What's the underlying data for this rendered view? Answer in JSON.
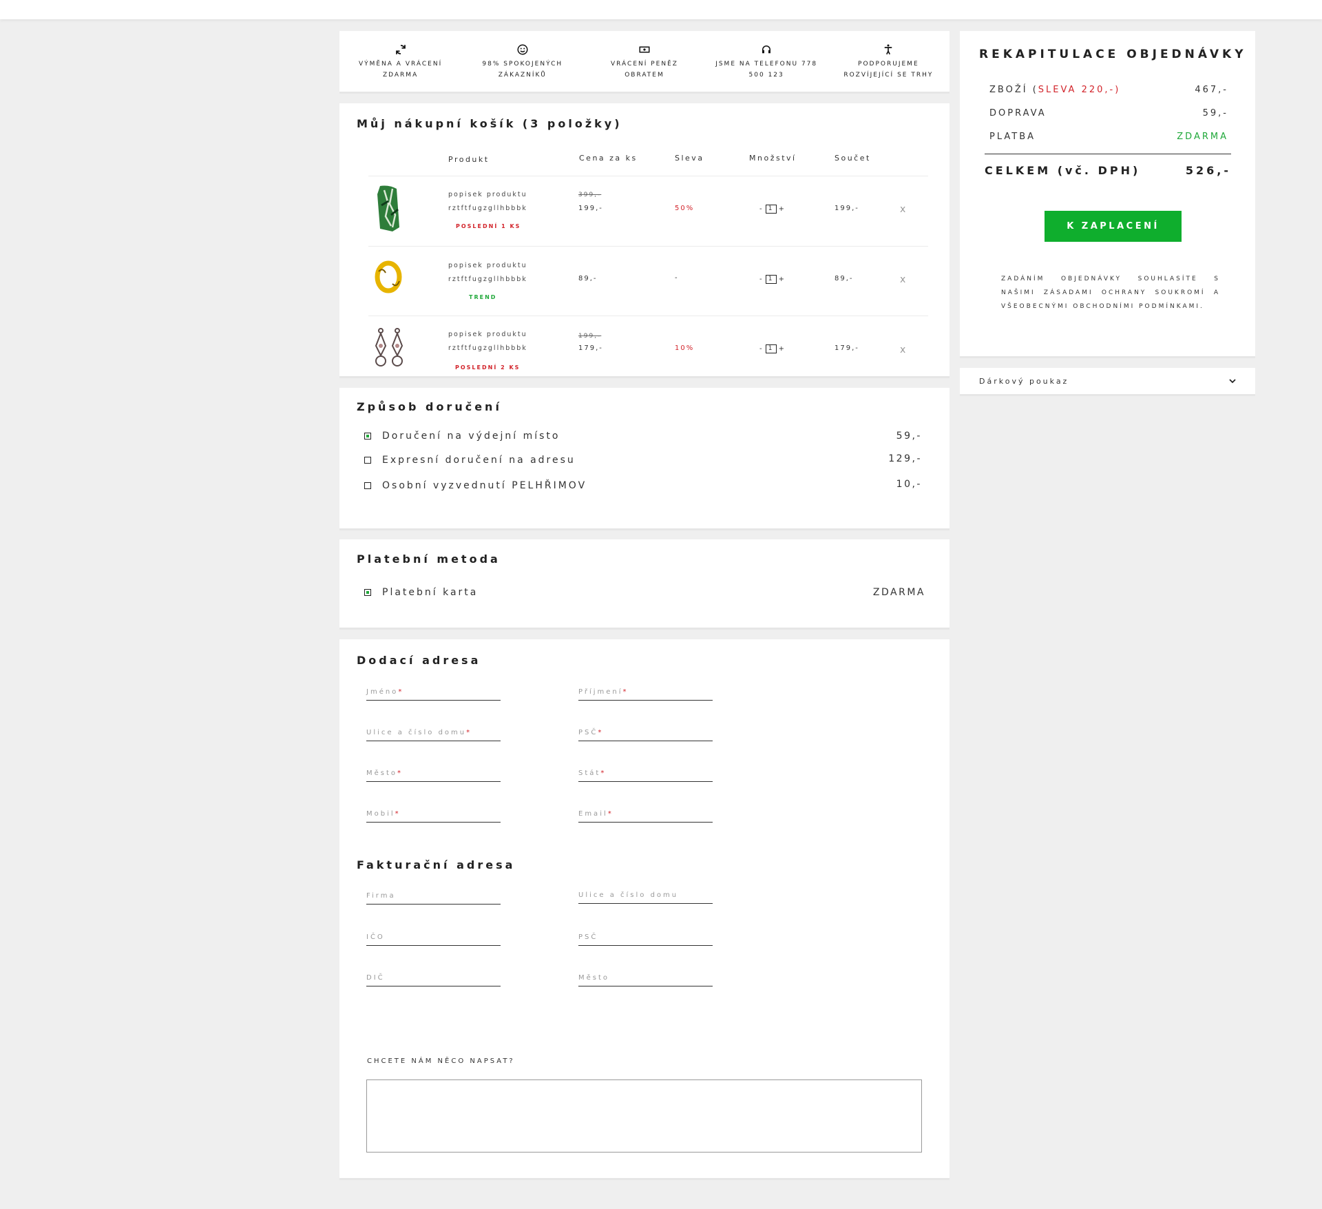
{
  "benefits": [
    {
      "icon": "refresh-icon",
      "label": "Výměna a vrácení zdarma"
    },
    {
      "icon": "smile-icon",
      "label": "98% spokojených zákazníků"
    },
    {
      "icon": "money-icon",
      "label": "Vrácení peněz obratem"
    },
    {
      "icon": "headset-icon",
      "label": "Jsme na telefonu 778 500 123"
    },
    {
      "icon": "person-icon",
      "label": "Podporujeme rozvíjející se trhy"
    }
  ],
  "cart": {
    "title": "Můj nákupní košík (3 položky)",
    "columns": {
      "product": "Produkt",
      "unit_price": "Cena za ks",
      "discount": "Sleva",
      "quantity": "Množství",
      "total": "Součet"
    },
    "items": [
      {
        "line1": "popisek produktu",
        "line2": "rztftfugzgllhbbbk",
        "badge": "POSLEDNÍ 1 KS",
        "badge_color": "#d2232a",
        "old_price": "399,-",
        "price": "199,-",
        "discount": "50%",
        "qty": "1",
        "total": "199,-",
        "remove": "x"
      },
      {
        "line1": "popisek produktu",
        "line2": "rztftfugzgllhbbbk",
        "badge": "TREND",
        "badge_color": "#20a83a",
        "old_price": "",
        "price": "89,-",
        "discount": "-",
        "qty": "1",
        "total": "89,-",
        "remove": "x"
      },
      {
        "line1": "popisek produktu",
        "line2": "rztftfugzgllhbbbk",
        "badge": "POSLEDNÍ 2 KS",
        "badge_color": "#d2232a",
        "old_price": "199,-",
        "price": "179,-",
        "discount": "10%",
        "qty": "1",
        "total": "179,-",
        "remove": "x"
      }
    ],
    "qty_minus": "-",
    "qty_plus": "+"
  },
  "delivery": {
    "title": "Způsob doručení",
    "options": [
      {
        "label": "Doručení na výdejní místo",
        "price": "59,-",
        "selected": true
      },
      {
        "label": "Expresní doručení na adresu",
        "price": "129,-",
        "selected": false
      },
      {
        "label": "Osobní vyzvednutí PELHŘIMOV",
        "price": "10,-",
        "selected": false
      }
    ]
  },
  "payment": {
    "title": "Platební metoda",
    "options": [
      {
        "label": "Platební karta",
        "price": "ZDARMA",
        "selected": true
      }
    ]
  },
  "delivery_address": {
    "title": "Dodací adresa",
    "fields": {
      "first_name": "Jméno",
      "last_name": "Příjmení",
      "street": "Ulice a číslo domu",
      "zip": "PSČ",
      "city": "Město",
      "country": "Stát",
      "mobile": "Mobil",
      "email": "Email"
    },
    "required_mark": "*"
  },
  "billing_address": {
    "title": "Fakturační adresa",
    "fields": {
      "company": "Firma",
      "street": "Ulice a číslo domu",
      "ico": "IČO",
      "zip": "PSČ",
      "dic": "DIČ",
      "city": "Město"
    }
  },
  "notes": {
    "label": "CHCETE NÁM NĚCO NAPSAT?",
    "value": ""
  },
  "summary": {
    "title": "REKAPITULACE OBJEDNÁVKY",
    "goods_label": "ZBOŽÍ (",
    "goods_discount": "SLEVA 220,-",
    "goods_close": ")",
    "goods_value": "467,-",
    "shipping_label": "DOPRAVA",
    "shipping_value": "59,-",
    "payment_label": "PLATBA",
    "payment_value": "ZDARMA",
    "total_label": "CELKEM (vč. DPH)",
    "total_value": "526,-",
    "pay_button": "K ZAPLACENÍ",
    "consent": "Zadáním objednávky souhlasíte s našimi zásadami ochrany soukromí a všeobecnými obchodními podmínkami."
  },
  "gift": {
    "label": "Dárkový poukaz"
  },
  "colors": {
    "accent_green": "#0fae2d",
    "discount_red": "#d2232a",
    "background": "#efefef"
  }
}
